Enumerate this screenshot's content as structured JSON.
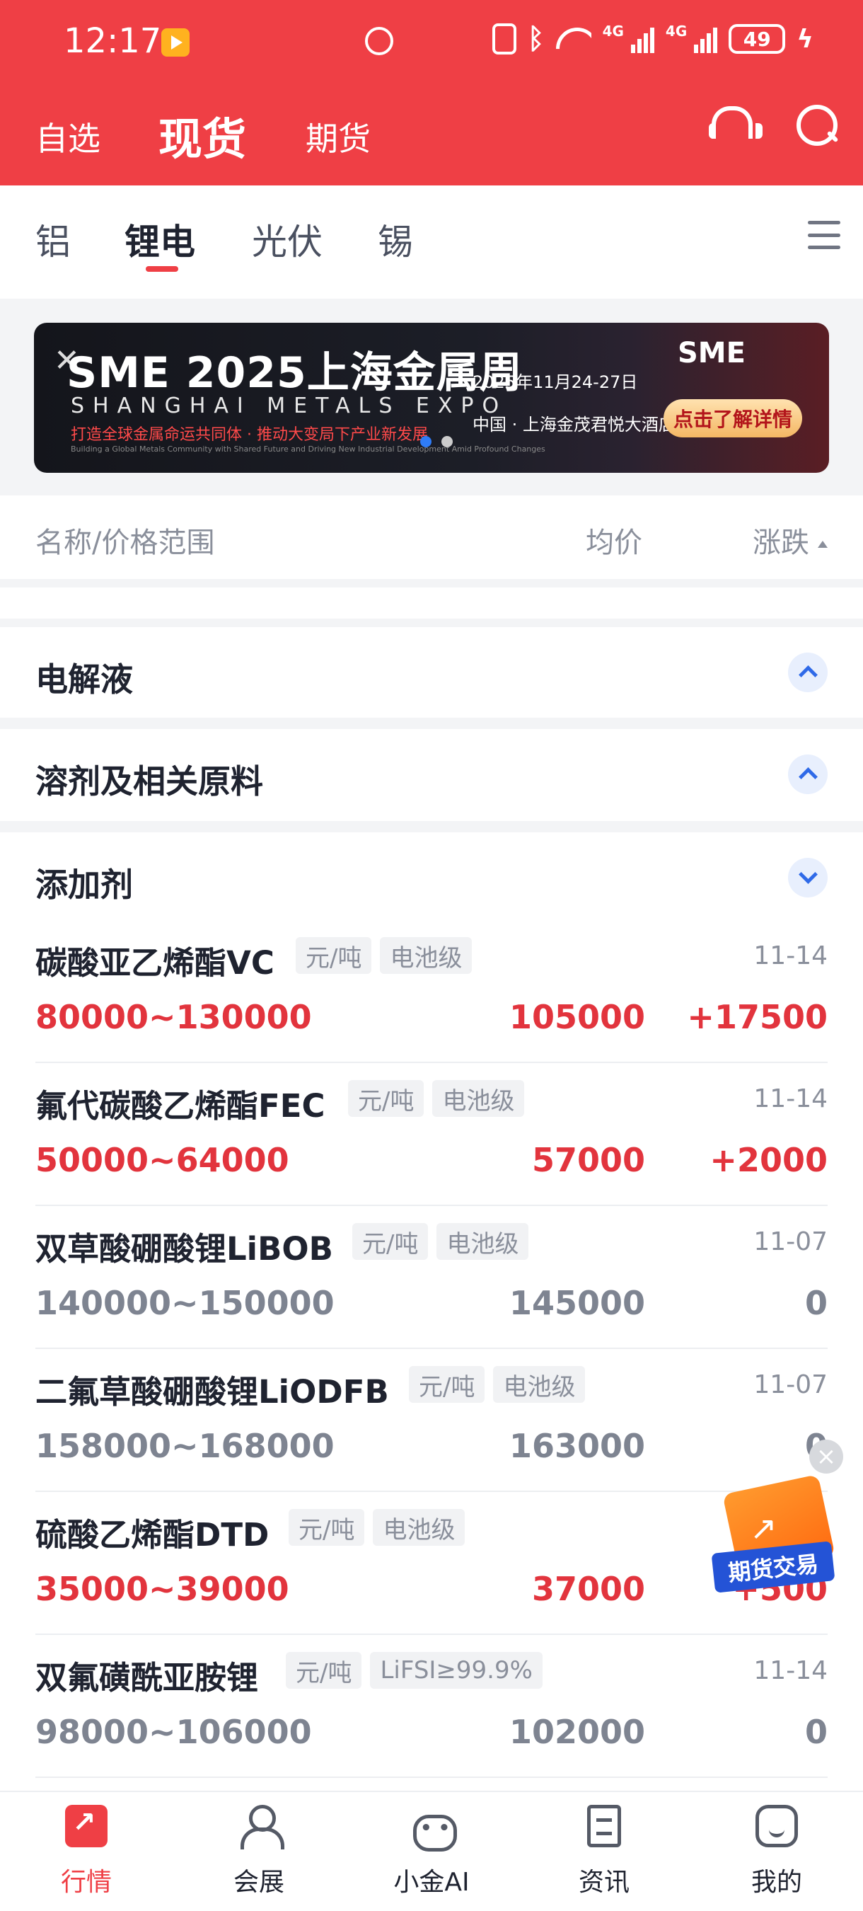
{
  "status_bar": {
    "time": "12:17",
    "network_1": "4G",
    "network_2": "4G",
    "battery": "49"
  },
  "header": {
    "tabs": [
      "自选",
      "现货",
      "期货"
    ],
    "active_tab": "现货"
  },
  "categories": {
    "items": [
      "铝",
      "锂电",
      "光伏",
      "锡"
    ],
    "active": "锂电"
  },
  "banner": {
    "title": "SME 2025上海金属周",
    "subtitle": "SHANGHAI METALS EXPO",
    "slogan": "打造全球金属命运共同体 · 推动大变局下产业新发展",
    "fine_print": "Building a Global Metals Community with Shared Future and Driving New Industrial Development Amid Profound Changes",
    "date": "2025年11月24-27日",
    "venue": "中国 · 上海金茂君悦大酒店",
    "brand": "SME",
    "cta": "点击了解详情"
  },
  "list_header": {
    "name_col": "名称/价格范围",
    "avg_col": "均价",
    "change_col": "涨跌"
  },
  "groups": [
    {
      "title": "电解液",
      "expanded": false
    },
    {
      "title": "溶剂及相关原料",
      "expanded": false
    },
    {
      "title": "添加剂",
      "expanded": true
    }
  ],
  "items": [
    {
      "name": "碳酸亚乙烯酯VC",
      "tags": [
        "元/吨",
        "电池级"
      ],
      "date": "11-14",
      "range": "80000~130000",
      "avg": "105000",
      "change": "+17500",
      "trend": "up"
    },
    {
      "name": "氟代碳酸乙烯酯FEC",
      "tags": [
        "元/吨",
        "电池级"
      ],
      "date": "11-14",
      "range": "50000~64000",
      "avg": "57000",
      "change": "+2000",
      "trend": "up"
    },
    {
      "name": "双草酸硼酸锂LiBOB",
      "tags": [
        "元/吨",
        "电池级"
      ],
      "date": "11-07",
      "range": "140000~150000",
      "avg": "145000",
      "change": "0",
      "trend": "flat"
    },
    {
      "name": "二氟草酸硼酸锂LiODFB",
      "tags": [
        "元/吨",
        "电池级"
      ],
      "date": "11-07",
      "range": "158000~168000",
      "avg": "163000",
      "change": "0",
      "trend": "flat"
    },
    {
      "name": "硫酸乙烯酯DTD",
      "tags": [
        "元/吨",
        "电池级"
      ],
      "date": "",
      "range": "35000~39000",
      "avg": "37000",
      "change": "+500",
      "trend": "up"
    },
    {
      "name": "双氟磺酰亚胺锂",
      "tags": [
        "元/吨",
        "LiFSI≥99.9%"
      ],
      "date": "11-14",
      "range": "98000~106000",
      "avg": "102000",
      "change": "0",
      "trend": "flat"
    }
  ],
  "floating": {
    "trade_label": "期货交易",
    "close_label": "×"
  },
  "bottom_nav": [
    "行情",
    "会展",
    "小金AI",
    "资讯",
    "我的"
  ],
  "colors": {
    "brand_red": "#ef3f45",
    "up": "#e2343d",
    "flat": "#7e8491",
    "accent_blue": "#2f6ae8"
  }
}
